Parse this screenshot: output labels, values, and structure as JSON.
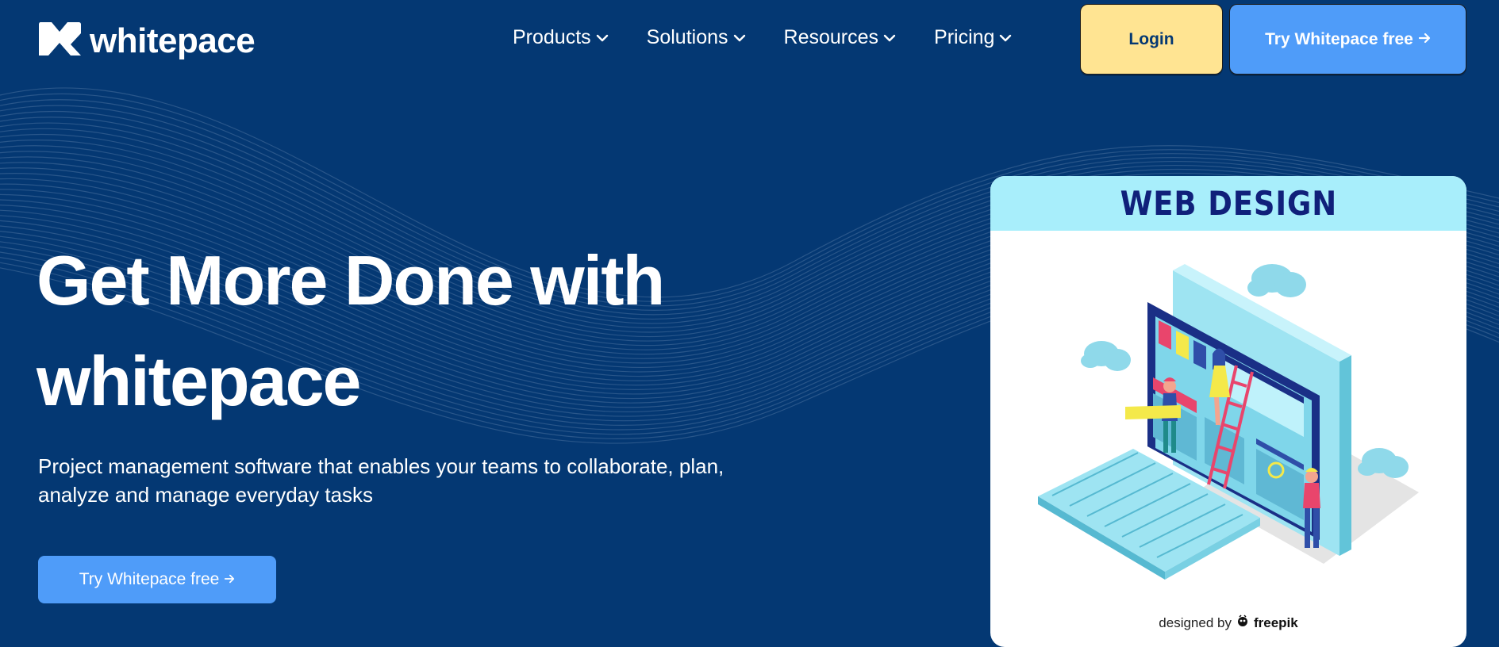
{
  "header": {
    "logo_text": "whitepace",
    "nav": [
      {
        "label": "Products"
      },
      {
        "label": "Solutions"
      },
      {
        "label": "Resources"
      },
      {
        "label": "Pricing"
      }
    ],
    "login_label": "Login",
    "try_label": "Try Whitepace free"
  },
  "hero": {
    "title_line1": "Get More Done with",
    "title_line2": "whitepace",
    "subtitle_line1": "Project management software that enables your teams to collaborate, plan,",
    "subtitle_line2": "analyze and manage everyday tasks",
    "cta_label": "Try Whitepace free"
  },
  "card": {
    "heading": "WEB DESIGN",
    "credit_prefix": "designed by",
    "credit_brand": "freepik"
  },
  "icons": {
    "logo": "whitepace-logo-icon",
    "chevron": "chevron-down-icon",
    "arrow": "arrow-right-icon"
  },
  "colors": {
    "background": "#043873",
    "login_button": "#FFE492",
    "primary_button": "#4F9CF9",
    "card_header": "#A8EEFB"
  }
}
